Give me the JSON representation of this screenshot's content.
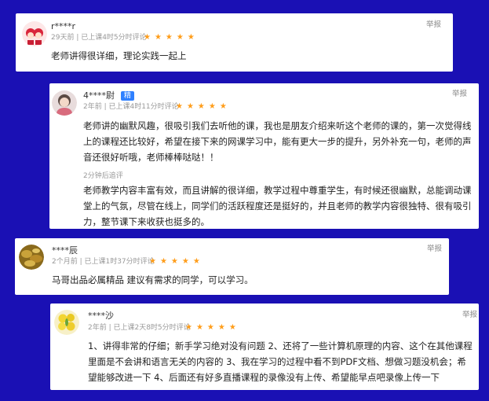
{
  "reviews": [
    {
      "name": "r****r",
      "meta": "29天前 | 已上课4时5分时评论",
      "stars": "★★★★★",
      "report": "举报",
      "text": "老师讲得很详细，理论实践一起上",
      "avatar": "avatar-girl-cartoon"
    },
    {
      "name": "4****尉",
      "badge": "精",
      "meta": "2年前 | 已上课4时11分时评论",
      "stars": "★★★★★",
      "report": "举报",
      "text": "老师讲的幽默风趣，很吸引我们去听他的课，我也是朋友介绍来听这个老师的课的，第一次觉得线上的课程还比较好，希望在接下来的网课学习中，能有更大一步的提升，另外补充一句，老师的声音还很好听哦，老师棒棒哒哒！！",
      "followup_label": "2分钟后追评",
      "followup_text": "老师教学内容丰富有效，而且讲解的很详细，教学过程中尊重学生，有时候还很幽默，总能调动课堂上的气氛，尽管在线上，同学们的活跃程度还是挺好的，并且老师的教学内容很独特、很有吸引力，整节课下来收获也挺多的。",
      "avatar": "avatar-girl-photo"
    },
    {
      "name": "****辰",
      "meta": "2个月前 | 已上课1时37分时评论",
      "stars": "★★★★★",
      "report": "举报",
      "text": "马哥出品必属精品 建议有需求的同学，可以学习。",
      "avatar": "avatar-leaves-photo"
    },
    {
      "name": "****沙",
      "meta": "2年前 | 已上课2天8时5分时评论",
      "stars": "★★★★★",
      "report": "举报",
      "text": "1、讲得非常的仔细；新手学习绝对没有问题 2、还将了一些计算机原理的内容、这个在其他课程里面是不会讲和语言无关的内容的 3、我在学习的过程中看不到PDF文档、想做习题没机会；希望能够改进一下 4、后面还有好多直播课程的录像没有上传、希望能早点吧录像上传一下",
      "avatar": "avatar-lemons-photo"
    }
  ],
  "colors": {
    "background": "#1a10b4",
    "star": "#ff9d1a",
    "badge": "#2f80ff"
  }
}
